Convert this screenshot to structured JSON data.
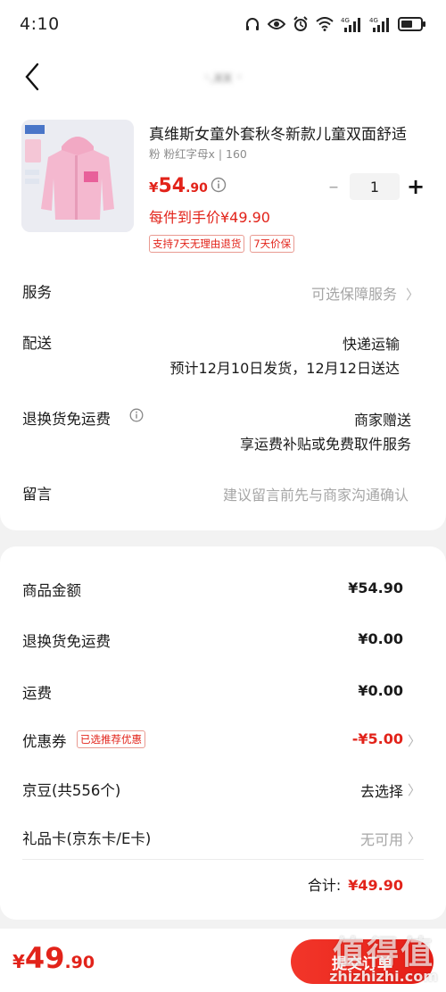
{
  "status_bar": {
    "time": "4:10",
    "icons": [
      "headphones-icon",
      "eye-icon",
      "alarm-icon",
      "wifi-icon",
      "signal-4g-icon",
      "signal-4g-icon",
      "battery-icon"
    ]
  },
  "nav": {
    "title": "·.xx ·"
  },
  "product": {
    "title": "真维斯女童外套秋冬新款儿童双面舒适",
    "spec": "粉 粉红字母x | 160",
    "price_symbol": "¥",
    "price_int": "54",
    "price_dec": ".90",
    "per_price": "每件到手价¥49.90",
    "quantity": "1",
    "tags": [
      "支持7天无理由退货",
      "7天价保"
    ],
    "image_colors": {
      "jacket": "#f4b8cf",
      "bg": "#e9eaf0"
    }
  },
  "service": {
    "label": "服务",
    "value": "可选保障服务"
  },
  "delivery": {
    "label": "配送",
    "method": "快递运输",
    "eta": "预计12月10日发货，12月12日送达"
  },
  "return_shipping": {
    "label": "退换货免运费",
    "value": "商家赠送",
    "detail": "享运费补贴或免费取件服务"
  },
  "message": {
    "label": "留言",
    "placeholder": "建议留言前先与商家沟通确认"
  },
  "summary": {
    "goods_label": "商品金额",
    "goods_value": "¥54.90",
    "return_label": "退换货免运费",
    "return_value": "¥0.00",
    "freight_label": "运费",
    "freight_value": "¥0.00",
    "coupon_label": "优惠券",
    "coupon_badge": "已选推荐优惠",
    "coupon_value": "-¥5.00",
    "jingdou_label": "京豆(共556个)",
    "jingdou_value": "去选择",
    "giftcard_label": "礼品卡(京东卡/E卡)",
    "giftcard_value": "无可用",
    "total_label": "合计:",
    "total_value": "¥49.90"
  },
  "bottom": {
    "price_symbol": "¥",
    "price_int": "49",
    "price_dec": ".90",
    "submit_label": "提交订单"
  },
  "watermark": {
    "main": "值得值",
    "sub": "zhizhizhi.com"
  },
  "colors": {
    "accent": "#e2231a",
    "muted": "#a6a6a6"
  }
}
